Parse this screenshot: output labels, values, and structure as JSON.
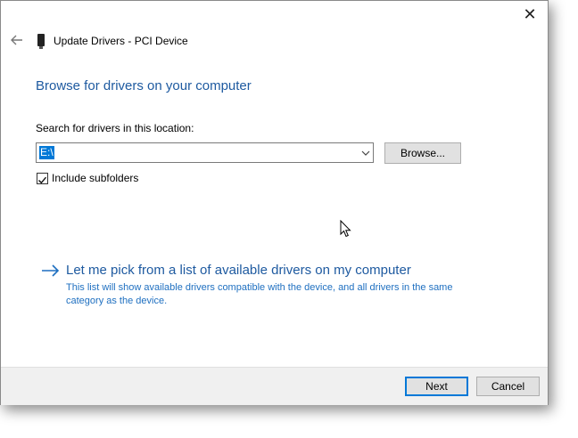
{
  "window": {
    "title": "Update Drivers - PCI Device",
    "close_glyph": "✕"
  },
  "main": {
    "heading": "Browse for drivers on your computer",
    "search_label": "Search for drivers in this location:",
    "location_value": "E:\\",
    "browse_label": "Browse...",
    "include_subfolders_label": "Include subfolders",
    "include_subfolders_checked": true,
    "pick_link_title": "Let me pick from a list of available drivers on my computer",
    "pick_link_desc": "This list will show available drivers compatible with the device, and all drivers in the same category as the device."
  },
  "footer": {
    "next_label": "Next",
    "cancel_label": "Cancel"
  },
  "icons": {
    "back": "back-arrow-icon",
    "device": "pci-device-icon",
    "close": "close-icon",
    "dropdown": "chevron-down-icon",
    "check": "checkmark-icon",
    "link": "right-arrow-icon",
    "cursor": "mouse-pointer-icon"
  },
  "colors": {
    "accent": "#1e5aa0",
    "selection": "#0078d7",
    "footer_bg": "#f0f0f0"
  }
}
